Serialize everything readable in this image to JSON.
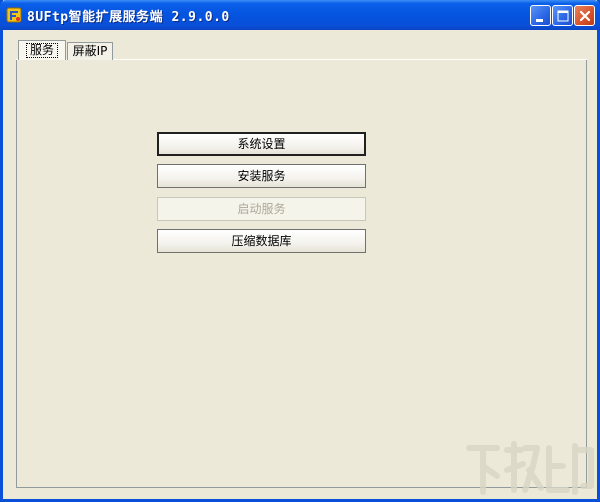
{
  "window": {
    "title": "8UFtp智能扩展服务端 2.9.0.0"
  },
  "tabs": [
    {
      "label": "服务",
      "active": true
    },
    {
      "label": "屏蔽IP",
      "active": false
    }
  ],
  "buttons": [
    {
      "label": "系统设置",
      "state": "default"
    },
    {
      "label": "安装服务",
      "state": "normal"
    },
    {
      "label": "启动服务",
      "state": "disabled"
    },
    {
      "label": "压缩数据库",
      "state": "normal"
    }
  ],
  "icons": {
    "app": "ftp-app-icon",
    "minimize": "minimize-icon",
    "maximize": "maximize-icon",
    "close": "close-icon"
  },
  "colors": {
    "titlebar": "#0a4fd8",
    "close_button": "#d7522b",
    "window_bg": "#ece9d8",
    "disabled_text": "#aca899"
  }
}
